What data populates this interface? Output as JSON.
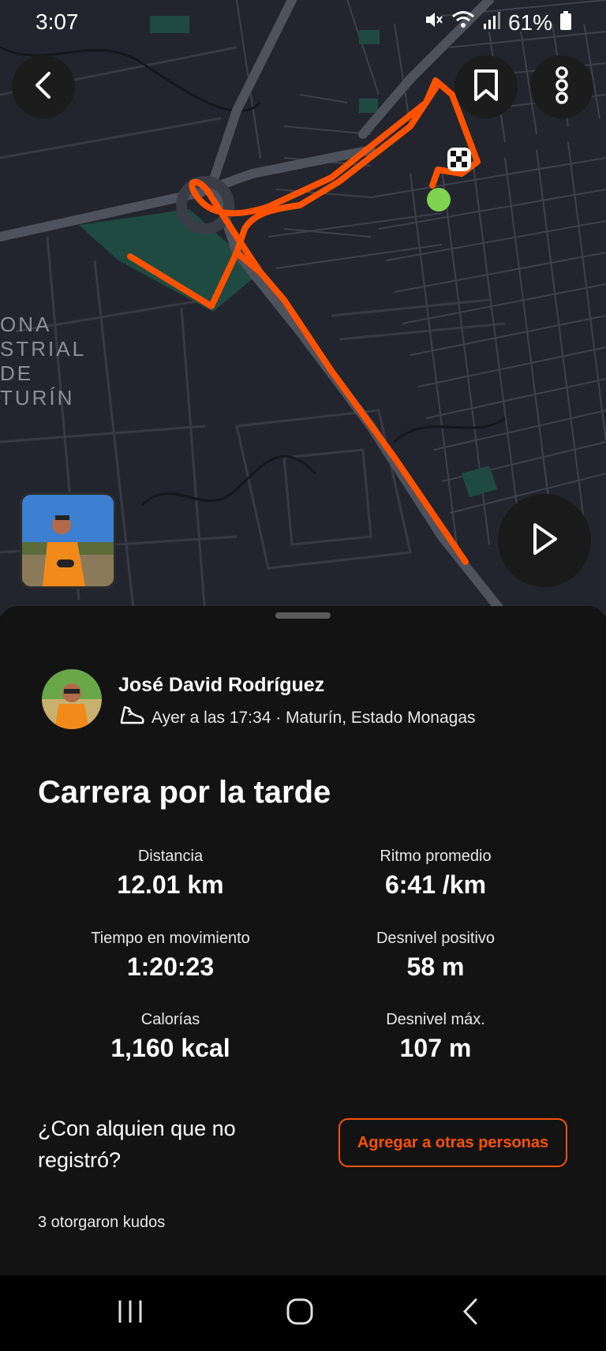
{
  "status_bar": {
    "time": "3:07",
    "battery": "61%"
  },
  "map": {
    "district_label_lines": [
      "ONA",
      "STRIAL",
      "DE",
      "TURÍN"
    ],
    "route_color": "#fc5200",
    "start_color": "#7fd34e"
  },
  "icons": {
    "back": "chevron-left-icon",
    "bookmark": "bookmark-icon",
    "more": "more-vertical-icon",
    "play": "play-icon",
    "run": "running-shoe-icon"
  },
  "activity": {
    "athlete_name": "José David Rodríguez",
    "meta": "Ayer a las 17:34 · Maturín, Estado Monagas",
    "title": "Carrera por la tarde"
  },
  "stats": [
    {
      "label": "Distancia",
      "value": "12.01 km"
    },
    {
      "label": "Ritmo promedio",
      "value": "6:41 /km"
    },
    {
      "label": "Tiempo en movimiento",
      "value": "1:20:23"
    },
    {
      "label": "Desnivel positivo",
      "value": "58 m"
    },
    {
      "label": "Calorías",
      "value": "1,160 kcal"
    },
    {
      "label": "Desnivel máx.",
      "value": "107 m"
    }
  ],
  "add_people": {
    "question": "¿Con alquien que no registró?",
    "button_label": "Agregar a otras personas"
  },
  "kudos_text": "3 otorgaron kudos",
  "accent_color": "#fc5200"
}
